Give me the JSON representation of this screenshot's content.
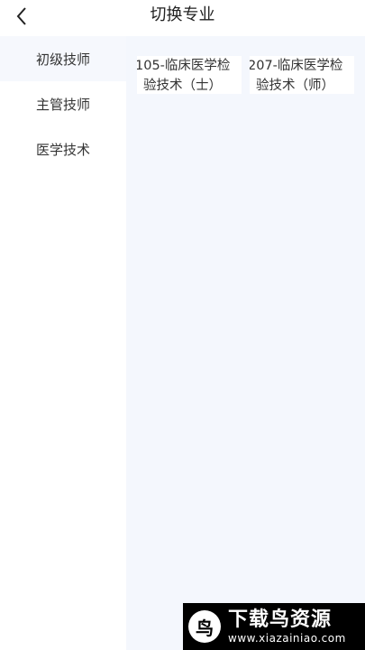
{
  "header": {
    "title": "切换专业",
    "back_icon": "chevron-left-icon"
  },
  "sidebar": {
    "items": [
      {
        "label": "初级技师",
        "active": true
      },
      {
        "label": "主管技师",
        "active": false
      },
      {
        "label": "医学技术",
        "active": false
      }
    ]
  },
  "content": {
    "cards": [
      {
        "line1": "105-临床医学检",
        "line2": "验技术（士）"
      },
      {
        "line1": "207-临床医学检",
        "line2": "验技术（师）"
      }
    ]
  },
  "watermark": {
    "name": "下载鸟资源",
    "url": "www.xiazainiao.com"
  },
  "colors": {
    "content_bg": "#f4f7fd",
    "sidebar_active_bg": "#f6f8fd",
    "text": "#333333"
  }
}
